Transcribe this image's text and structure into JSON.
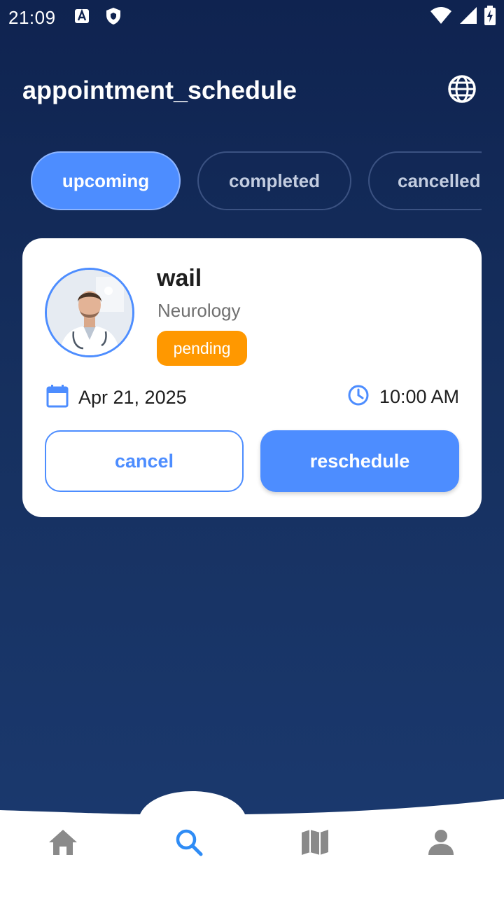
{
  "status_bar": {
    "time": "21:09",
    "left_icons": [
      "accessibility-font-icon",
      "shield-icon"
    ],
    "right_icons": [
      "wifi-icon",
      "signal-icon",
      "battery-icon"
    ]
  },
  "header": {
    "title": "appointment_schedule",
    "language_icon": "globe-icon"
  },
  "tabs": [
    {
      "label": "upcoming",
      "active": true
    },
    {
      "label": "completed",
      "active": false
    },
    {
      "label": "cancelled",
      "active": false
    }
  ],
  "appointment": {
    "doctor_name": "wail",
    "specialty": "Neurology",
    "status": "pending",
    "date": "Apr 21, 2025",
    "time": "10:00 AM",
    "cancel_label": "cancel",
    "reschedule_label": "reschedule"
  },
  "bottom_nav": [
    {
      "icon": "home-icon",
      "active": false
    },
    {
      "icon": "search-icon",
      "active": true
    },
    {
      "icon": "map-icon",
      "active": false
    },
    {
      "icon": "person-icon",
      "active": false
    }
  ],
  "colors": {
    "accent": "#4d8dff",
    "background_top": "#0f2350",
    "background_bottom": "#1b3a70",
    "pending": "#ff9800",
    "nav_inactive": "#8a8a8a"
  }
}
